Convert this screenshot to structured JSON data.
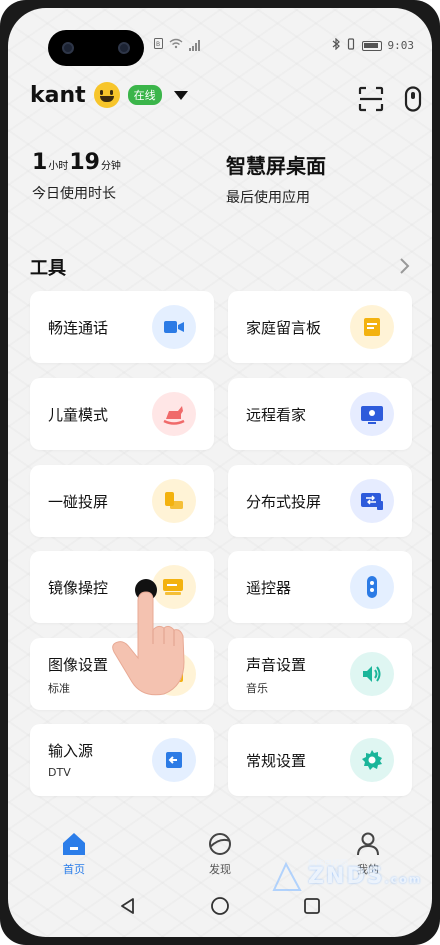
{
  "status_bar": {
    "time": "9:03"
  },
  "header": {
    "username": "kant",
    "status_badge": "在线"
  },
  "stats": {
    "usage": {
      "hours": "1",
      "hours_unit": "小时",
      "minutes": "19",
      "minutes_unit": "分钟",
      "label": "今日使用时长"
    },
    "last_app": {
      "value": "智慧屏桌面",
      "label": "最后使用应用"
    }
  },
  "tools": {
    "title": "工具",
    "items": [
      {
        "label": "畅连通话",
        "sub": "",
        "icon": "video-call-icon",
        "bg": "#e4efff",
        "color": "#2c7be5"
      },
      {
        "label": "家庭留言板",
        "sub": "",
        "icon": "notepad-icon",
        "bg": "#fff3d6",
        "color": "#f3b20f"
      },
      {
        "label": "儿童模式",
        "sub": "",
        "icon": "rocking-horse-icon",
        "bg": "#ffe6e6",
        "color": "#f06a6a"
      },
      {
        "label": "远程看家",
        "sub": "",
        "icon": "monitor-icon",
        "bg": "#e6ecff",
        "color": "#2e5bdb"
      },
      {
        "label": "一碰投屏",
        "sub": "",
        "icon": "tap-cast-icon",
        "bg": "#fff3d6",
        "color": "#f3b20f"
      },
      {
        "label": "分布式投屏",
        "sub": "",
        "icon": "distributed-cast-icon",
        "bg": "#e6ecff",
        "color": "#2e5bdb"
      },
      {
        "label": "镜像操控",
        "sub": "",
        "icon": "mirror-control-icon",
        "bg": "#fff3d6",
        "color": "#f3b20f"
      },
      {
        "label": "遥控器",
        "sub": "",
        "icon": "remote-control-icon",
        "bg": "#e4efff",
        "color": "#2c7be5"
      },
      {
        "label": "图像设置",
        "sub": "标准",
        "icon": "image-settings-icon",
        "bg": "#fff3d6",
        "color": "#f3b20f"
      },
      {
        "label": "声音设置",
        "sub": "音乐",
        "icon": "speaker-icon",
        "bg": "#dff6f2",
        "color": "#1bb59a"
      },
      {
        "label": "输入源",
        "sub": "DTV",
        "icon": "input-source-icon",
        "bg": "#e4efff",
        "color": "#2c7be5"
      },
      {
        "label": "常规设置",
        "sub": "",
        "icon": "gear-icon",
        "bg": "#dff6f2",
        "color": "#1bb59a"
      }
    ]
  },
  "bottom_nav": {
    "home": "首页",
    "discover": "发现",
    "mine": "我的"
  },
  "watermark": {
    "text": "ZNDS",
    "small": "智能电视网",
    "domain": ".com"
  },
  "accent_color": "#2b7de9"
}
